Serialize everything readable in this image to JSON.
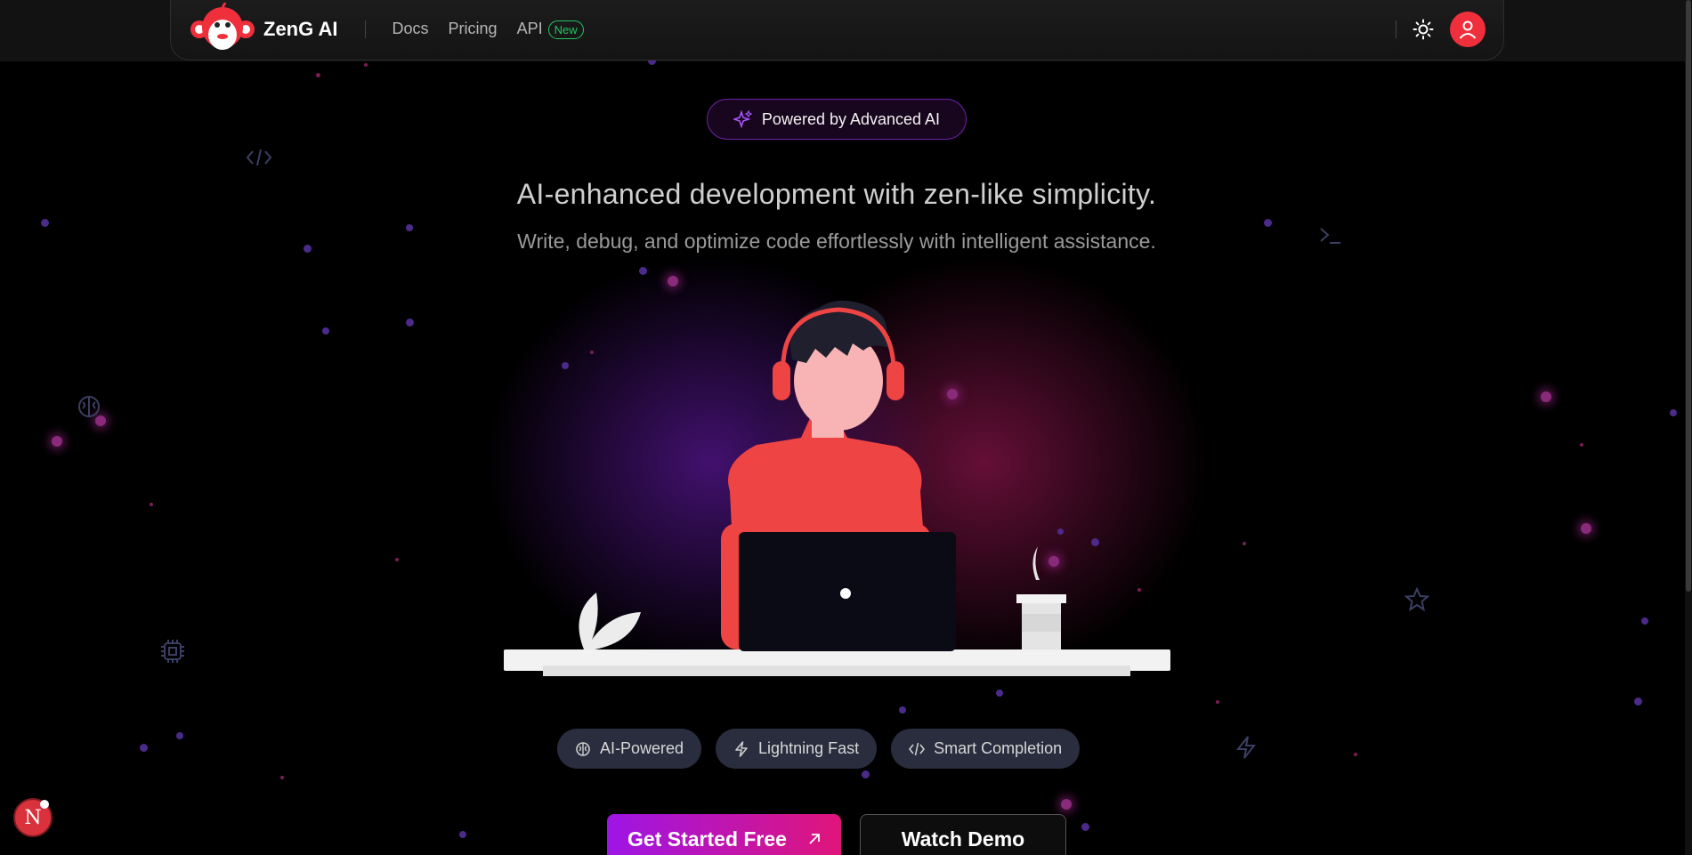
{
  "nav": {
    "brand": "ZenG AI",
    "links": [
      {
        "label": "Docs"
      },
      {
        "label": "Pricing"
      },
      {
        "label": "API",
        "badge": "New"
      }
    ]
  },
  "hero": {
    "pill": "Powered by Advanced AI",
    "headline": "AI-enhanced development with zen-like simplicity.",
    "subline": "Write, debug, and optimize code effortlessly with intelligent assistance."
  },
  "features": [
    {
      "label": "AI-Powered",
      "icon": "brain-icon"
    },
    {
      "label": "Lightning Fast",
      "icon": "lightning-icon"
    },
    {
      "label": "Smart Completion",
      "icon": "code-icon"
    }
  ],
  "cta": {
    "primary": "Get Started Free",
    "secondary": "Watch Demo"
  },
  "floating_badge": "N",
  "colors": {
    "accent_purple": "#9d15e6",
    "accent_pink": "#e0157a",
    "brand_red": "#ef2f3c",
    "badge_green": "#22c55e"
  }
}
